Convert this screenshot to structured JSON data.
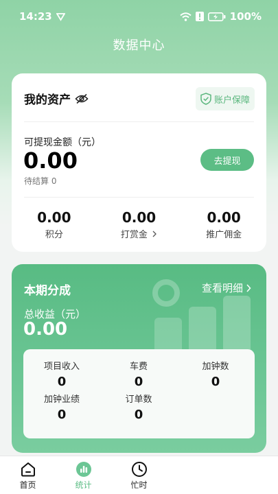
{
  "status_bar": {
    "time": "14:23",
    "battery": "100%"
  },
  "header": {
    "title": "数据中心"
  },
  "assets": {
    "title": "我的资产",
    "protect_label": "账户保障",
    "withdraw_label": "可提现金额（元）",
    "withdraw_amount": "0.00",
    "pending_text": "待结算 0",
    "withdraw_button": "去提现",
    "stats": [
      {
        "value": "0.00",
        "label": "积分"
      },
      {
        "value": "0.00",
        "label": "打赏金"
      },
      {
        "value": "0.00",
        "label": "推广佣金"
      }
    ]
  },
  "share": {
    "title": "本期分成",
    "detail_link": "查看明细",
    "total_label": "总收益（元）",
    "total_amount": "0.00",
    "metrics": [
      {
        "label": "项目收入",
        "value": "0"
      },
      {
        "label": "车费",
        "value": "0"
      },
      {
        "label": "加钟数",
        "value": "0"
      },
      {
        "label": "加钟业绩",
        "value": "0"
      },
      {
        "label": "订单数",
        "value": "0"
      }
    ]
  },
  "tabs": [
    {
      "label": "首页",
      "icon": "home-icon"
    },
    {
      "label": "统计",
      "icon": "stats-icon"
    },
    {
      "label": "忙时",
      "icon": "clock-icon"
    }
  ],
  "colors": {
    "accent": "#5cbd85",
    "header_bg": "#8fd3a6"
  }
}
